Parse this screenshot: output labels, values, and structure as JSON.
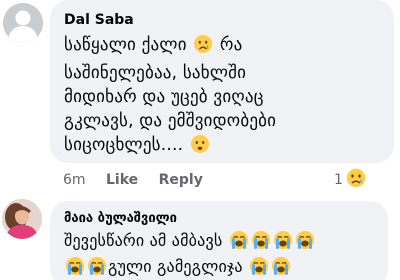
{
  "comments": [
    {
      "author": "Dal Saba",
      "lines": [
        [
          "საწყალი ქალი ",
          "sad-tear",
          " რა"
        ],
        [
          "საშინელებაა, სახლში"
        ],
        [
          "მიდიხარ და უცებ ვიღაც"
        ],
        [
          "გკლავს, და ემშვიდობები"
        ],
        [
          "სიცოცხლეს.... ",
          "frown"
        ]
      ],
      "time": "6m",
      "like_label": "Like",
      "reply_label": "Reply",
      "reaction_count": "1",
      "reaction_icon": "sad-reaction-icon"
    },
    {
      "author": "მაია ბულაშვილი",
      "lines": [
        [
          "შევესწარი ამ ამბავს ",
          "crying x4"
        ],
        [
          "crying x2",
          "გული გამეგლიჯა ",
          "crying x2"
        ]
      ]
    }
  ],
  "colors": {
    "bubble_bg": "#f0f2f5",
    "meta_text": "#65676b",
    "primary_text": "#050505",
    "emoji_yellow": "#ffcc4d",
    "tear_blue": "#5dadec"
  }
}
